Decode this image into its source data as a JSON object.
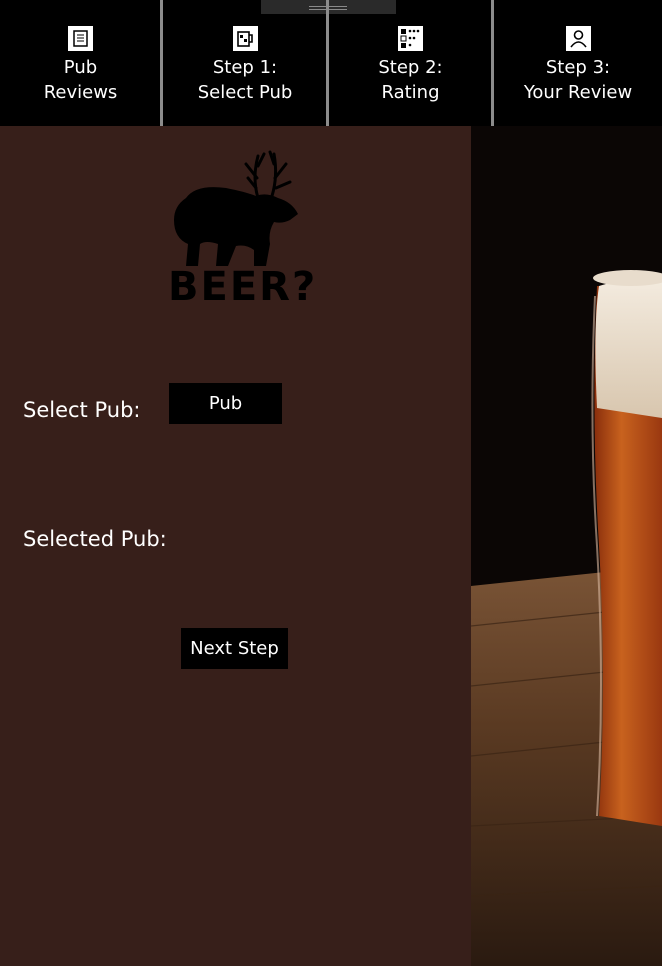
{
  "nav": {
    "tabs": [
      {
        "line1": "Pub",
        "line2": "Reviews",
        "icon": "document-list-icon"
      },
      {
        "line1": "Step 1:",
        "line2": "Select Pub",
        "icon": "beer-mug-icon"
      },
      {
        "line1": "Step 2:",
        "line2": "Rating",
        "icon": "checklist-icon"
      },
      {
        "line1": "Step 3:",
        "line2": "Your Review",
        "icon": "person-icon"
      }
    ]
  },
  "logo": {
    "text": "BEER?",
    "icon": "bear-with-antlers-icon"
  },
  "form": {
    "select_pub_label": "Select Pub:",
    "pub_button": "Pub",
    "selected_pub_label": "Selected Pub:",
    "next_button": "Next Step"
  },
  "colors": {
    "panel": "#371f1a",
    "topbar": "#000000",
    "beer": "#b5501a"
  }
}
